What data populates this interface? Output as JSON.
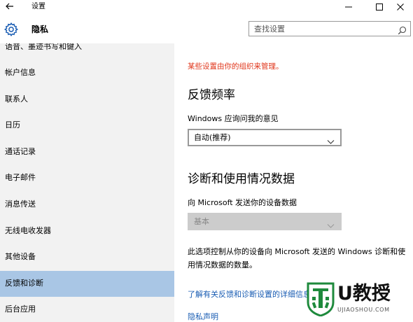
{
  "window": {
    "title": "设置",
    "controls": [
      "minimize",
      "maximize",
      "close"
    ]
  },
  "header": {
    "title": "隐私",
    "search_placeholder": "查找设置"
  },
  "sidebar": {
    "items": [
      {
        "label": "语音、墨迹书写和键入",
        "active": false
      },
      {
        "label": "帐户信息",
        "active": false
      },
      {
        "label": "联系人",
        "active": false
      },
      {
        "label": "日历",
        "active": false
      },
      {
        "label": "通话记录",
        "active": false
      },
      {
        "label": "电子邮件",
        "active": false
      },
      {
        "label": "消息传送",
        "active": false
      },
      {
        "label": "无线电收发器",
        "active": false
      },
      {
        "label": "其他设备",
        "active": false
      },
      {
        "label": "反馈和诊断",
        "active": true
      },
      {
        "label": "后台应用",
        "active": false
      }
    ]
  },
  "main": {
    "org_note": "某些设置由你的组织来管理。",
    "feedback": {
      "heading": "反馈频率",
      "label": "Windows 应询问我的意见",
      "value": "自动(推荐)"
    },
    "diagnostics": {
      "heading": "诊断和使用情况数据",
      "label": "向 Microsoft 发送你的设备数据",
      "value": "基本",
      "disabled": true
    },
    "description": "此选项控制从你的设备向 Microsoft 发送的 Windows 诊断和使用情况数据的数量。",
    "links": {
      "learn_more": "了解有关反馈和诊断设置的详细信息",
      "privacy": "隐私声明"
    }
  },
  "watermark": {
    "brand": "U教授",
    "domain": "UJIAOSHOU.COM"
  },
  "colors": {
    "sidebar_bg": "#f2f2f2",
    "active_item": "#a9c6e5",
    "org_note": "#e0361b",
    "link": "#1a5db3",
    "watermark_green": "#1e8a3c"
  }
}
